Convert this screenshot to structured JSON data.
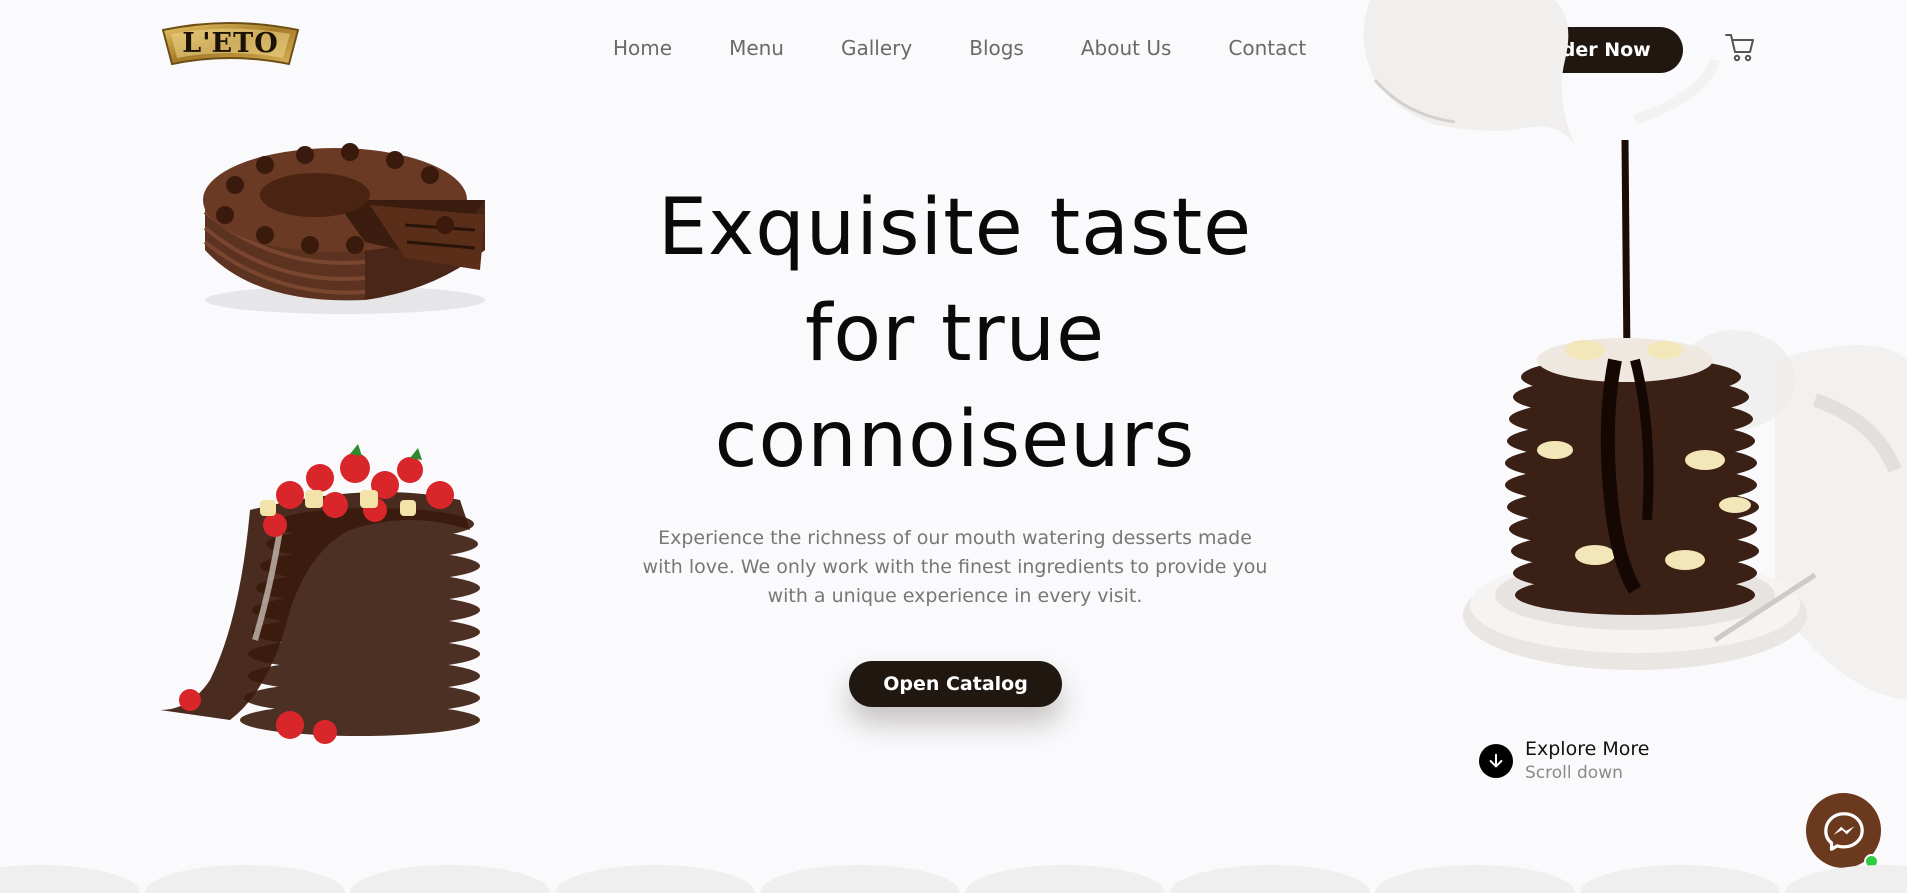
{
  "brand": {
    "logo_text": "L'ETO"
  },
  "nav": {
    "items": [
      "Home",
      "Menu",
      "Gallery",
      "Blogs",
      "About Us",
      "Contact"
    ]
  },
  "header": {
    "order_label": "Order Now"
  },
  "hero": {
    "title_line1": "Exquisite taste",
    "title_line2": "for true",
    "title_line3": "connoiseurs",
    "description": "Experience the richness of our mouth watering desserts made with love. We only work with the finest ingredients to provide you with a unique experience in every visit.",
    "cta_label": "Open Catalog"
  },
  "explore": {
    "title": "Explore More",
    "subtitle": "Scroll down"
  },
  "icons": {
    "cart": "cart-icon",
    "arrow": "arrow-down-icon",
    "messenger": "messenger-icon"
  },
  "colors": {
    "background": "#fafafc",
    "button_dark": "#201710",
    "logo_gold": "#c9a24a",
    "messenger_brown": "#6b3a1e",
    "online_green": "#2ecc40"
  }
}
